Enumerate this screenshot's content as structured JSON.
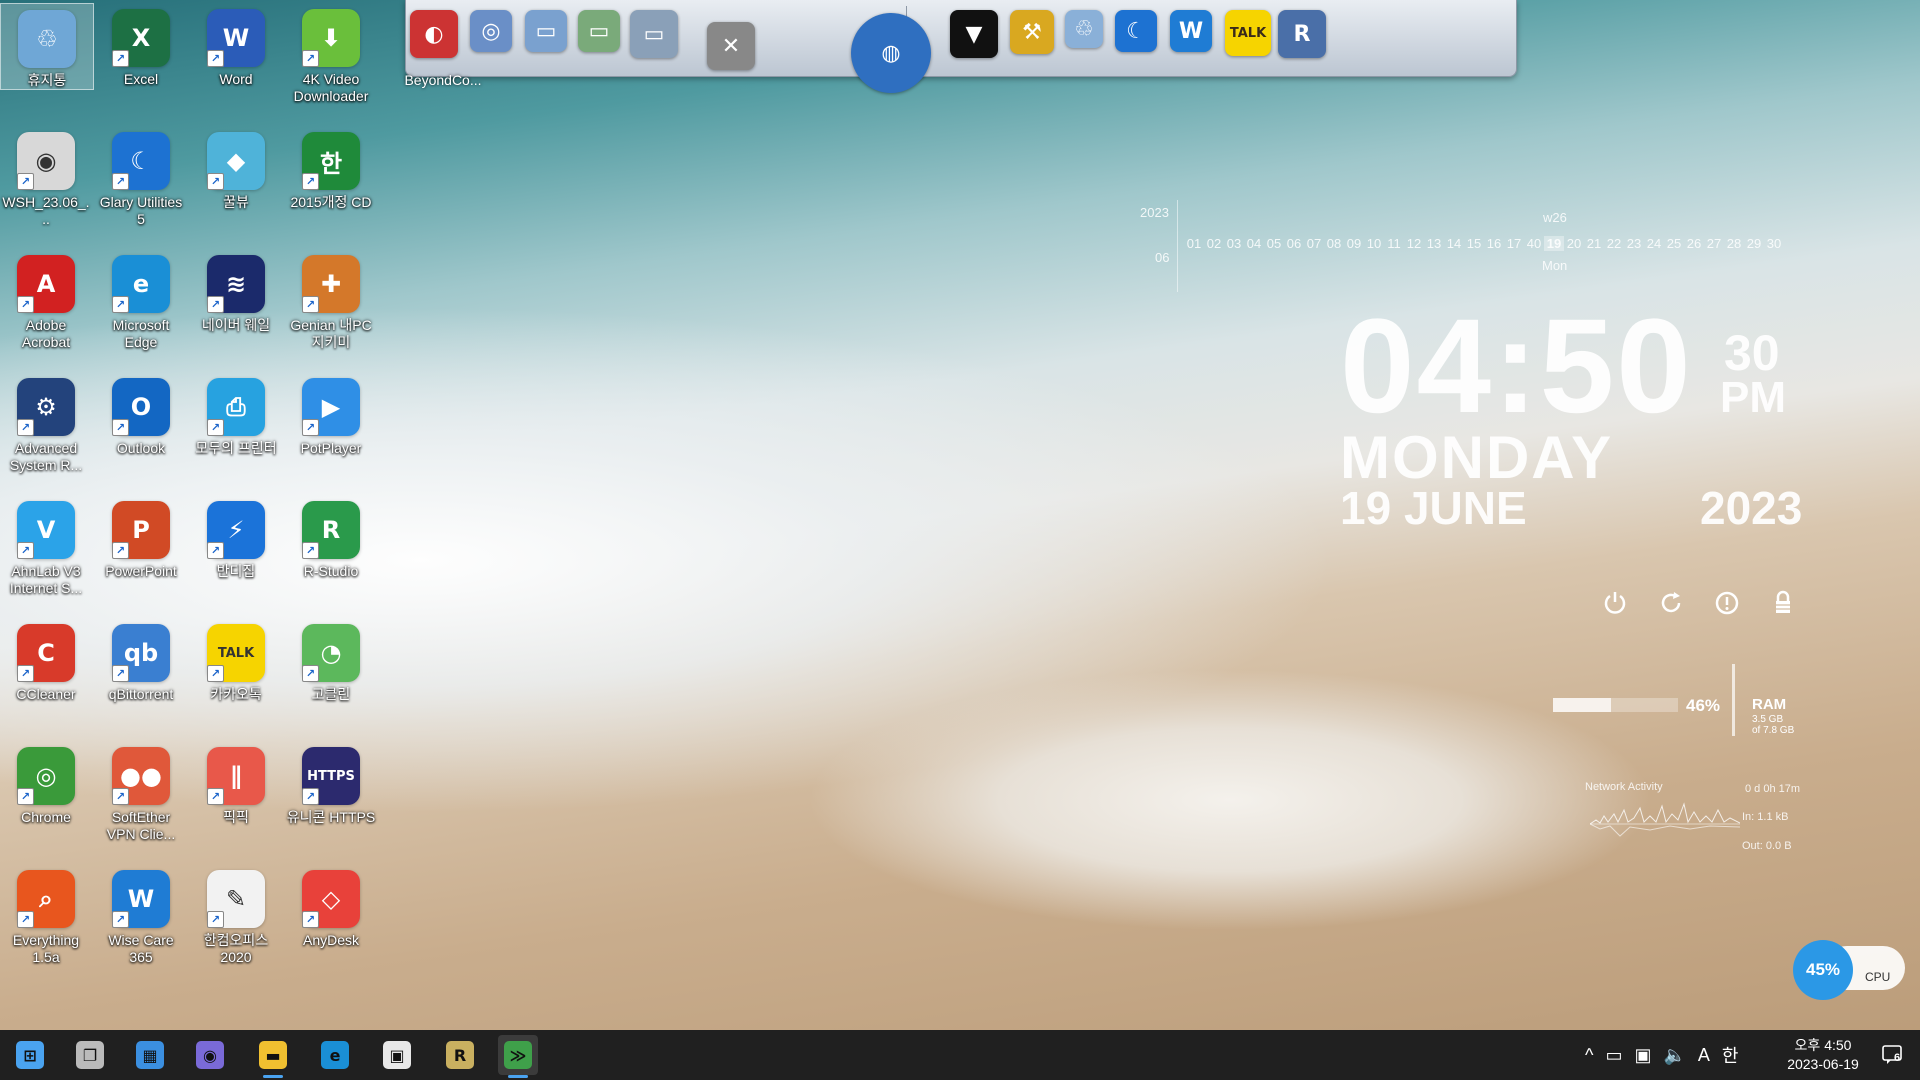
{
  "desktop": {
    "icons": [
      {
        "label": "휴지통",
        "glyph": "♲",
        "color": "#6fa7d6"
      },
      {
        "label": "Excel",
        "glyph": "X",
        "color": "#1d7044"
      },
      {
        "label": "Word",
        "glyph": "W",
        "color": "#2b5cb8"
      },
      {
        "label": "4K Video Downloader",
        "glyph": "⬇",
        "color": "#6abf3b"
      },
      {
        "label": "WSH_23.06_...",
        "glyph": "◉",
        "color": "#d8d8d8"
      },
      {
        "label": "Glary Utilities 5",
        "glyph": "☾",
        "color": "#1d72d2"
      },
      {
        "label": "꿀뷰",
        "glyph": "◆",
        "color": "#4fb3d9"
      },
      {
        "label": "2015개정 CD",
        "glyph": "한",
        "color": "#1f8a3a"
      },
      {
        "label": "Adobe Acrobat",
        "glyph": "A",
        "color": "#d22121"
      },
      {
        "label": "Microsoft Edge",
        "glyph": "e",
        "color": "#1a8fd6"
      },
      {
        "label": "네이버 웨일",
        "glyph": "≋",
        "color": "#1b2a6b"
      },
      {
        "label": "Genian 내PC지키미",
        "glyph": "✚",
        "color": "#d4782a"
      },
      {
        "label": "Advanced System R...",
        "glyph": "⚙",
        "color": "#23437c"
      },
      {
        "label": "Outlook",
        "glyph": "O",
        "color": "#1367c3"
      },
      {
        "label": "모두의 프린터",
        "glyph": "⎙",
        "color": "#27a2e0"
      },
      {
        "label": "PotPlayer",
        "glyph": "▶",
        "color": "#2f8fe6"
      },
      {
        "label": "AhnLab V3 Internet S...",
        "glyph": "V",
        "color": "#2ba3e8"
      },
      {
        "label": "PowerPoint",
        "glyph": "P",
        "color": "#d14a25"
      },
      {
        "label": "반디집",
        "glyph": "⚡",
        "color": "#1b73d9"
      },
      {
        "label": "R-Studio",
        "glyph": "R",
        "color": "#2a9a4b"
      },
      {
        "label": "CCleaner",
        "glyph": "C",
        "color": "#d83a2a"
      },
      {
        "label": "qBittorrent",
        "glyph": "qb",
        "color": "#3a7fd1"
      },
      {
        "label": "카카오톡",
        "glyph": "TALK",
        "color": "#f6d400"
      },
      {
        "label": "고클린",
        "glyph": "◔",
        "color": "#5cb85c"
      },
      {
        "label": "Chrome",
        "glyph": "◎",
        "color": "#3a9a3a"
      },
      {
        "label": "SoftEther VPN Clie...",
        "glyph": "●●",
        "color": "#e0583a"
      },
      {
        "label": "픽픽",
        "glyph": "∥",
        "color": "#e8584a"
      },
      {
        "label": "유니콘 HTTPS",
        "glyph": "HTTPS",
        "color": "#2c2a6e"
      },
      {
        "label": "Everything 1.5a",
        "glyph": "⌕",
        "color": "#e8561e"
      },
      {
        "label": "Wise Care 365",
        "glyph": "W",
        "color": "#1f7cd4"
      },
      {
        "label": "한컴오피스 2020",
        "glyph": "✎",
        "color": "#f2f2f2"
      },
      {
        "label": "AnyDesk",
        "glyph": "◇",
        "color": "#e8413a"
      }
    ]
  },
  "dock": {
    "label_first": "BeyondCo...",
    "items": [
      {
        "name": "beyond-compare-icon",
        "glyph": "◐",
        "color": "#c33"
      },
      {
        "name": "network-globe-icon",
        "glyph": "◎",
        "color": "#6a8fc7"
      },
      {
        "name": "folder-icon",
        "glyph": "▭",
        "color": "#7aa1cf"
      },
      {
        "name": "green-folder-icon",
        "glyph": "▭",
        "color": "#7aaa7a"
      },
      {
        "name": "drive-folder-icon",
        "glyph": "▭",
        "color": "#8aa0b8"
      },
      {
        "name": "tools-icon",
        "glyph": "✕",
        "color": "#888"
      },
      {
        "name": "globe-icon",
        "glyph": "◍",
        "color": "#2f6fc0"
      },
      {
        "name": "tshirt-icon",
        "glyph": "▼",
        "color": "#111"
      },
      {
        "name": "hammer-icon",
        "glyph": "⚒",
        "color": "#d9a820"
      },
      {
        "name": "recycle-bin-icon",
        "glyph": "♲",
        "color": "#8ab0d8"
      },
      {
        "name": "glary-icon",
        "glyph": "☾",
        "color": "#1d72d2"
      },
      {
        "name": "wise-shield-icon",
        "glyph": "W",
        "color": "#1f7cd4"
      },
      {
        "name": "kakaotalk-icon",
        "glyph": "TALK",
        "color": "#f6d400"
      },
      {
        "name": "r-tool-icon",
        "glyph": "R",
        "color": "#4a6fa8"
      }
    ]
  },
  "calendar": {
    "year": "2023",
    "month": "06",
    "week": "w26",
    "days": [
      "01",
      "02",
      "03",
      "04",
      "05",
      "06",
      "07",
      "08",
      "09",
      "10",
      "11",
      "12",
      "13",
      "14",
      "15",
      "16",
      "17",
      "40",
      "19",
      "20",
      "21",
      "22",
      "23",
      "24",
      "25",
      "26",
      "27",
      "28",
      "29",
      "30"
    ],
    "today_index": 18,
    "dow": "Mon"
  },
  "clock": {
    "time": "04:50",
    "seconds": "30",
    "ampm": "PM",
    "day": "MONDAY",
    "date": "19 JUNE",
    "year": "2023"
  },
  "ram": {
    "percent_text": "46%",
    "percent": 0.46,
    "label": "RAM",
    "used": "3.5 GB",
    "total": "of 7.8 GB"
  },
  "network": {
    "title": "Network Activity",
    "uptime": "0 d 0h 17m",
    "in": "In: 1.1 kB",
    "out": "Out: 0.0 B"
  },
  "cpu": {
    "percent_text": "45%",
    "label": "CPU"
  },
  "taskbar": {
    "apps": [
      {
        "name": "start-button",
        "glyph": "⊞",
        "color": "#4aa3f0"
      },
      {
        "name": "task-view-button",
        "glyph": "❐",
        "color": "#bbb"
      },
      {
        "name": "widgets-button",
        "glyph": "▦",
        "color": "#3b8fe0"
      },
      {
        "name": "teams-chat-button",
        "glyph": "◉",
        "color": "#7a6ad8"
      },
      {
        "name": "file-explorer-button",
        "glyph": "▬",
        "color": "#f0c030"
      },
      {
        "name": "edge-taskbar-button",
        "glyph": "e",
        "color": "#1a8fd6"
      },
      {
        "name": "store-button",
        "glyph": "▣",
        "color": "#e8e8e8"
      },
      {
        "name": "r-app-button",
        "glyph": "R",
        "color": "#c9b060"
      },
      {
        "name": "rainmeter-button",
        "glyph": "≫",
        "color": "#3fa04a"
      }
    ],
    "tray": {
      "chevron": "^",
      "battery": "▭",
      "network": "▣",
      "volume": "🔈",
      "ime_a": "A",
      "ime_han": "한"
    },
    "clock_line1": "오후 4:50",
    "clock_line2": "2023-06-19",
    "notification_count": "6"
  }
}
